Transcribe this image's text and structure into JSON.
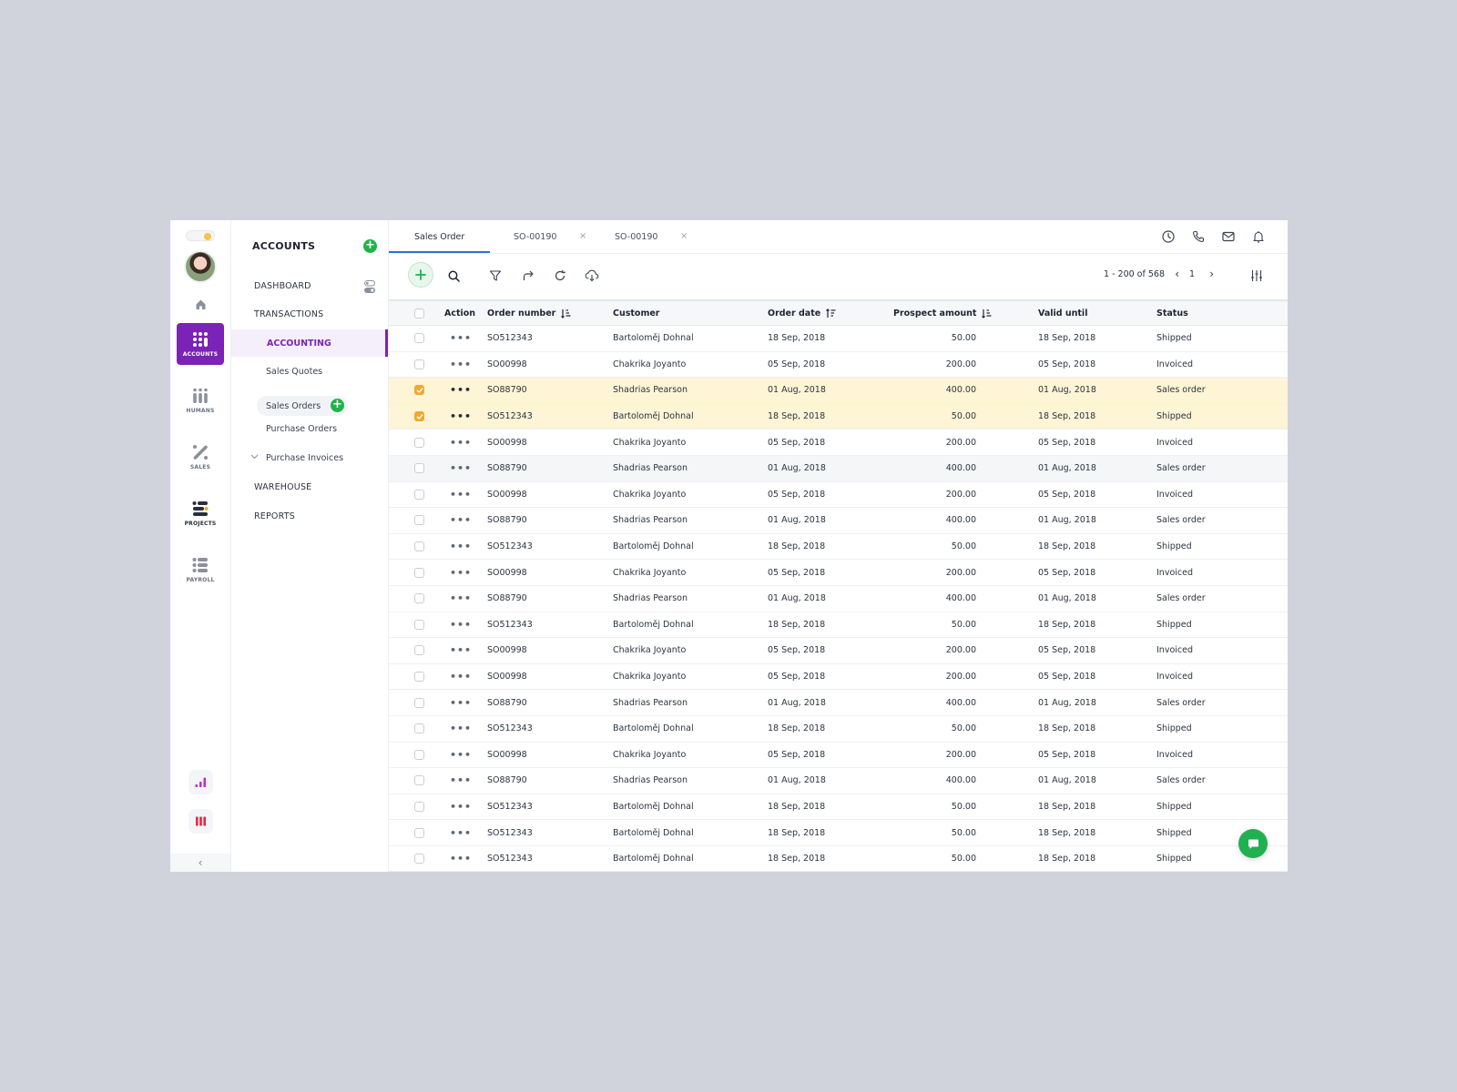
{
  "rail": {
    "items": [
      {
        "label": "ACCOUNTS",
        "icon": "grid-dots-icon",
        "active": true
      },
      {
        "label": "HUMANS",
        "icon": "people-bars-icon",
        "active": false
      },
      {
        "label": "SALES",
        "icon": "percent-icon",
        "active": false
      },
      {
        "label": "PROJECTS",
        "icon": "project-lines-icon",
        "active": false
      },
      {
        "label": "PAYROLL",
        "icon": "list-icon",
        "active": false
      }
    ],
    "bottom_icons": [
      "signal-bars-icon",
      "columns-icon"
    ],
    "colors": {
      "active": "#7a23b6",
      "signal": "#c026d3",
      "columns": "#f0253d",
      "toggle_knob": "#f7c343"
    }
  },
  "nav": {
    "title": "ACCOUNTS",
    "add_label": "+",
    "items": [
      {
        "label": "DASHBOARD",
        "level": "top"
      },
      {
        "label": "TRANSACTIONS",
        "level": "top"
      },
      {
        "label": "ACCOUNTING",
        "level": "active"
      },
      {
        "label": "Sales Quotes",
        "level": "sub"
      },
      {
        "label": "Sales Orders",
        "level": "sub",
        "add": "+"
      },
      {
        "label": "Purchase Orders",
        "level": "sub"
      },
      {
        "label": "Purchase Invoices",
        "level": "sub",
        "expandable": true
      },
      {
        "label": "WAREHOUSE",
        "level": "top"
      },
      {
        "label": "REPORTS",
        "level": "top"
      }
    ]
  },
  "tabs": [
    {
      "label": "Sales Order",
      "active": true,
      "closable": false
    },
    {
      "label": "SO-00190",
      "active": false,
      "closable": true
    },
    {
      "label": "SO-00190",
      "active": false,
      "closable": true
    }
  ],
  "tab_close": "×",
  "header_icons": [
    "clock-icon",
    "phone-icon",
    "mail-icon",
    "bell-icon"
  ],
  "toolbar": {
    "icons": [
      "add-icon",
      "search-icon",
      "filter-icon",
      "share-icon",
      "refresh-icon",
      "cloud-download-icon"
    ],
    "pager": {
      "range": "1 - 200 of 568",
      "page": "1",
      "prev": "‹",
      "next": "›"
    }
  },
  "table": {
    "columns": [
      {
        "key": "select",
        "label": ""
      },
      {
        "key": "action",
        "label": "Action"
      },
      {
        "key": "order",
        "label": "Order number",
        "sort": "desc"
      },
      {
        "key": "customer",
        "label": "Customer"
      },
      {
        "key": "date",
        "label": "Order date",
        "sort": "asc"
      },
      {
        "key": "amount",
        "label": "Prospect amount",
        "sort": "desc"
      },
      {
        "key": "valid",
        "label": "Valid until"
      },
      {
        "key": "status",
        "label": "Status"
      }
    ],
    "action_label": "•••",
    "rows": [
      {
        "order": "SO512343",
        "customer": "Bartoloměj Dohnal",
        "date": "18 Sep, 2018",
        "amount": "50.00",
        "valid": "18 Sep, 2018",
        "status": "Shipped",
        "selected": false
      },
      {
        "order": "SO00998",
        "customer": "Chakrika Joyanto",
        "date": "05 Sep, 2018",
        "amount": "200.00",
        "valid": "05 Sep, 2018",
        "status": "Invoiced",
        "selected": false
      },
      {
        "order": "SO88790",
        "customer": "Shadrias Pearson",
        "date": "01 Aug, 2018",
        "amount": "400.00",
        "valid": "01 Aug, 2018",
        "status": "Sales order",
        "selected": true
      },
      {
        "order": "SO512343",
        "customer": "Bartoloměj Dohnal",
        "date": "18 Sep, 2018",
        "amount": "50.00",
        "valid": "18 Sep, 2018",
        "status": "Shipped",
        "selected": true
      },
      {
        "order": "SO00998",
        "customer": "Chakrika Joyanto",
        "date": "05 Sep, 2018",
        "amount": "200.00",
        "valid": "05 Sep, 2018",
        "status": "Invoiced",
        "selected": false
      },
      {
        "order": "SO88790",
        "customer": "Shadrias Pearson",
        "date": "01 Aug, 2018",
        "amount": "400.00",
        "valid": "01 Aug, 2018",
        "status": "Sales order",
        "selected": false,
        "hover": true
      },
      {
        "order": "SO00998",
        "customer": "Chakrika Joyanto",
        "date": "05 Sep, 2018",
        "amount": "200.00",
        "valid": "05 Sep, 2018",
        "status": "Invoiced",
        "selected": false
      },
      {
        "order": "SO88790",
        "customer": "Shadrias Pearson",
        "date": "01 Aug, 2018",
        "amount": "400.00",
        "valid": "01 Aug, 2018",
        "status": "Sales order",
        "selected": false
      },
      {
        "order": "SO512343",
        "customer": "Bartoloměj Dohnal",
        "date": "18 Sep, 2018",
        "amount": "50.00",
        "valid": "18 Sep, 2018",
        "status": "Shipped",
        "selected": false
      },
      {
        "order": "SO00998",
        "customer": "Chakrika Joyanto",
        "date": "05 Sep, 2018",
        "amount": "200.00",
        "valid": "05 Sep, 2018",
        "status": "Invoiced",
        "selected": false
      },
      {
        "order": "SO88790",
        "customer": "Shadrias Pearson",
        "date": "01 Aug, 2018",
        "amount": "400.00",
        "valid": "01 Aug, 2018",
        "status": "Sales order",
        "selected": false
      },
      {
        "order": "SO512343",
        "customer": "Bartoloměj Dohnal",
        "date": "18 Sep, 2018",
        "amount": "50.00",
        "valid": "18 Sep, 2018",
        "status": "Shipped",
        "selected": false
      },
      {
        "order": "SO00998",
        "customer": "Chakrika Joyanto",
        "date": "05 Sep, 2018",
        "amount": "200.00",
        "valid": "05 Sep, 2018",
        "status": "Invoiced",
        "selected": false
      },
      {
        "order": "SO00998",
        "customer": "Chakrika Joyanto",
        "date": "05 Sep, 2018",
        "amount": "200.00",
        "valid": "05 Sep, 2018",
        "status": "Invoiced",
        "selected": false
      },
      {
        "order": "SO88790",
        "customer": "Shadrias Pearson",
        "date": "01 Aug, 2018",
        "amount": "400.00",
        "valid": "01 Aug, 2018",
        "status": "Sales order",
        "selected": false
      },
      {
        "order": "SO512343",
        "customer": "Bartoloměj Dohnal",
        "date": "18 Sep, 2018",
        "amount": "50.00",
        "valid": "18 Sep, 2018",
        "status": "Shipped",
        "selected": false
      },
      {
        "order": "SO00998",
        "customer": "Chakrika Joyanto",
        "date": "05 Sep, 2018",
        "amount": "200.00",
        "valid": "05 Sep, 2018",
        "status": "Invoiced",
        "selected": false
      },
      {
        "order": "SO88790",
        "customer": "Shadrias Pearson",
        "date": "01 Aug, 2018",
        "amount": "400.00",
        "valid": "01 Aug, 2018",
        "status": "Sales order",
        "selected": false
      },
      {
        "order": "SO512343",
        "customer": "Bartoloměj Dohnal",
        "date": "18 Sep, 2018",
        "amount": "50.00",
        "valid": "18 Sep, 2018",
        "status": "Shipped",
        "selected": false
      },
      {
        "order": "SO512343",
        "customer": "Bartoloměj Dohnal",
        "date": "18 Sep, 2018",
        "amount": "50.00",
        "valid": "18 Sep, 2018",
        "status": "Shipped",
        "selected": false
      },
      {
        "order": "SO512343",
        "customer": "Bartoloměj Dohnal",
        "date": "18 Sep, 2018",
        "amount": "50.00",
        "valid": "18 Sep, 2018",
        "status": "Shipped",
        "selected": false
      }
    ]
  },
  "chat": {
    "icon": "chat-bubble-icon",
    "color": "#21b050"
  },
  "collapse_label": "‹"
}
